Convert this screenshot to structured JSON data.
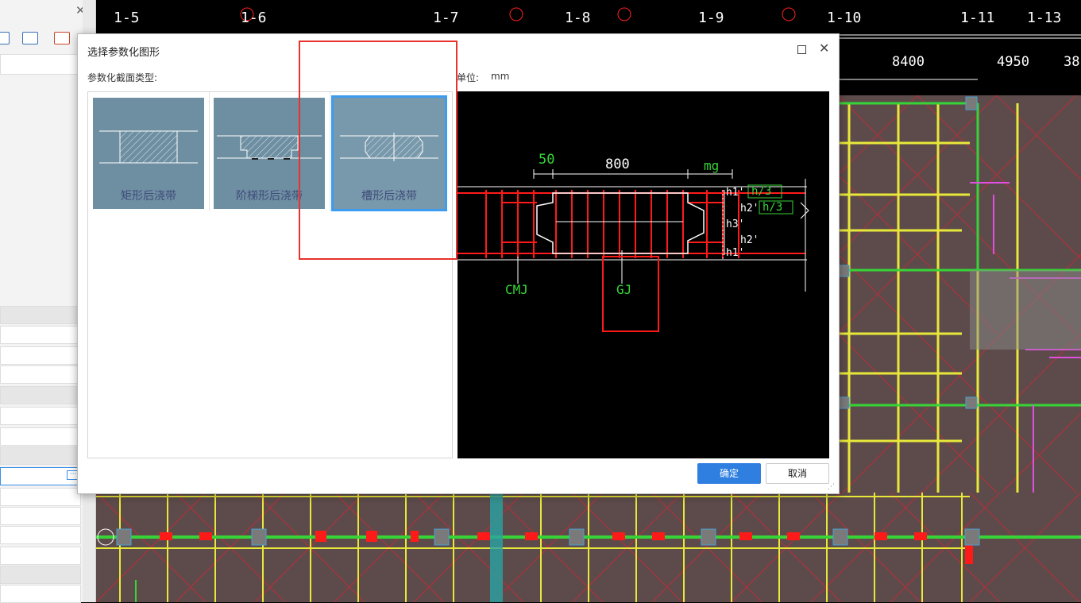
{
  "dialog": {
    "title": "选择参数化图形",
    "section_label": "参数化截面类型:",
    "unit_label": "单位:",
    "unit_value": "mm",
    "types": [
      {
        "label": "矩形后浇带",
        "selected": false
      },
      {
        "label": "阶梯形后浇带",
        "selected": false
      },
      {
        "label": "槽形后浇带",
        "selected": true
      }
    ],
    "ok_label": "确定",
    "cancel_label": "取消"
  },
  "preview": {
    "dim_50": "50",
    "dim_800": "800",
    "dim_mg": "mg",
    "h1_top": "h1'",
    "h3_box_top": "h/3",
    "h2_top": "h2'",
    "h3_box_bottom": "h/3",
    "h3": "h3'",
    "h2_bottom": "h2'",
    "h1_bottom": "h1'",
    "cmj": "CMJ",
    "gj": "GJ"
  },
  "cad": {
    "axes": [
      "1-5",
      "1-6",
      "1-7",
      "1-8",
      "1-9",
      "1-10",
      "1-11",
      "1-13"
    ],
    "dims": [
      "8400",
      "4950",
      "38"
    ]
  },
  "colors": {
    "accent": "#2f7fe0",
    "selected_border": "#3b9cf0",
    "thumb_bg": "#6e8fa2",
    "annotation_red": "#e8322b",
    "cad_green": "#37d437",
    "cad_red": "#ff1a1a"
  }
}
